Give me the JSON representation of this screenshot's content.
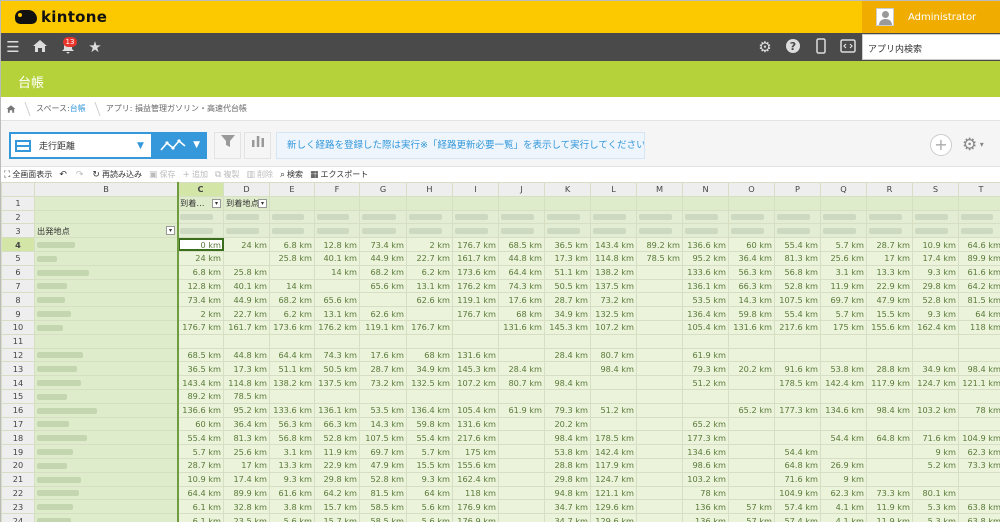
{
  "app": {
    "brand": "kintone",
    "user": "Administrator",
    "notification_count": "13",
    "app_search_label": "アプリ内検索",
    "title": "台帳"
  },
  "breadcrumb": {
    "space_prefix": "スペース:",
    "space_name": "台帳",
    "app_label": "アプリ: 損益管理ガソリン・高速代台帳"
  },
  "toolbar": {
    "view_name": "走行距離",
    "notice": "新しく経路を登録した際は実行※「経路更新必要一覧」を表示して実行してください"
  },
  "sheet_tools": [
    {
      "label": "全画面表示",
      "icon": "⛶",
      "enabled": true
    },
    {
      "label": "",
      "icon": "↶",
      "enabled": true
    },
    {
      "label": "",
      "icon": "↷",
      "enabled": false
    },
    {
      "label": "再読み込み",
      "icon": "↻",
      "enabled": true
    },
    {
      "label": "保存",
      "icon": "▣",
      "enabled": false
    },
    {
      "label": "追加",
      "icon": "+",
      "enabled": false
    },
    {
      "label": "複製",
      "icon": "⧉",
      "enabled": false
    },
    {
      "label": "削除",
      "icon": "▥",
      "enabled": false
    },
    {
      "label": "検索",
      "icon": "⌕",
      "enabled": true
    },
    {
      "label": "エクスポート",
      "icon": "▦",
      "enabled": true
    }
  ],
  "sheet": {
    "columns": [
      "B",
      "C",
      "D",
      "E",
      "F",
      "G",
      "H",
      "I",
      "J",
      "K",
      "L",
      "M",
      "N",
      "O",
      "P",
      "Q",
      "R",
      "S",
      "T"
    ],
    "selected_column": "C",
    "row1_labels": {
      "C": "到着…",
      "D": "到着地点"
    },
    "row3_label": "出発地点",
    "rows": [
      {
        "n": "4",
        "v": [
          "0 km",
          "24 km",
          "6.8 km",
          "12.8 km",
          "73.4 km",
          "2 km",
          "176.7 km",
          "68.5 km",
          "36.5 km",
          "143.4 km",
          "89.2 km",
          "136.6 km",
          "60 km",
          "55.4 km",
          "5.7 km",
          "28.7 km",
          "10.9 km",
          "64.6 km"
        ]
      },
      {
        "n": "5",
        "v": [
          "24 km",
          "",
          "25.8 km",
          "40.1 km",
          "44.9 km",
          "22.7 km",
          "161.7 km",
          "44.8 km",
          "17.3 km",
          "114.8 km",
          "78.5 km",
          "95.2 km",
          "36.4 km",
          "81.3 km",
          "25.6 km",
          "17 km",
          "17.4 km",
          "89.9 km"
        ]
      },
      {
        "n": "6",
        "v": [
          "6.8 km",
          "25.8 km",
          "",
          "14 km",
          "68.2 km",
          "6.2 km",
          "173.6 km",
          "64.4 km",
          "51.1 km",
          "138.2 km",
          "",
          "133.6 km",
          "56.3 km",
          "56.8 km",
          "3.1 km",
          "13.3 km",
          "9.3 km",
          "61.6 km"
        ]
      },
      {
        "n": "7",
        "v": [
          "12.8 km",
          "40.1 km",
          "14 km",
          "",
          "65.6 km",
          "13.1 km",
          "176.2 km",
          "74.3 km",
          "50.5 km",
          "137.5 km",
          "",
          "136.1 km",
          "66.3 km",
          "52.8 km",
          "11.9 km",
          "22.9 km",
          "29.8 km",
          "64.2 km"
        ]
      },
      {
        "n": "8",
        "v": [
          "73.4 km",
          "44.9 km",
          "68.2 km",
          "65.6 km",
          "",
          "62.6 km",
          "119.1 km",
          "17.6 km",
          "28.7 km",
          "73.2 km",
          "",
          "53.5 km",
          "14.3 km",
          "107.5 km",
          "69.7 km",
          "47.9 km",
          "52.8 km",
          "81.5 km"
        ]
      },
      {
        "n": "9",
        "v": [
          "2 km",
          "22.7 km",
          "6.2 km",
          "13.1 km",
          "62.6 km",
          "",
          "176.7 km",
          "68 km",
          "34.9 km",
          "132.5 km",
          "",
          "136.4 km",
          "59.8 km",
          "55.4 km",
          "5.7 km",
          "15.5 km",
          "9.3 km",
          "64 km"
        ]
      },
      {
        "n": "10",
        "v": [
          "176.7 km",
          "161.7 km",
          "173.6 km",
          "176.2 km",
          "119.1 km",
          "176.7 km",
          "",
          "131.6 km",
          "145.3 km",
          "107.2 km",
          "",
          "105.4 km",
          "131.6 km",
          "217.6 km",
          "175 km",
          "155.6 km",
          "162.4 km",
          "118 km"
        ]
      },
      {
        "n": "11",
        "v": [
          "",
          "",
          "",
          "",
          "",
          "",
          "",
          "",
          "",
          "",
          "",
          "",
          "",
          "",
          "",
          "",
          "",
          ""
        ]
      },
      {
        "n": "12",
        "v": [
          "68.5 km",
          "44.8 km",
          "64.4 km",
          "74.3 km",
          "17.6 km",
          "68 km",
          "131.6 km",
          "",
          "28.4 km",
          "80.7 km",
          "",
          "61.9 km",
          "",
          "",
          "",
          "",
          "",
          ""
        ]
      },
      {
        "n": "13",
        "v": [
          "36.5 km",
          "17.3 km",
          "51.1 km",
          "50.5 km",
          "28.7 km",
          "34.9 km",
          "145.3 km",
          "28.4 km",
          "",
          "98.4 km",
          "",
          "79.3 km",
          "20.2 km",
          "91.6 km",
          "53.8 km",
          "28.8 km",
          "34.9 km",
          "98.4 km"
        ]
      },
      {
        "n": "14",
        "v": [
          "143.4 km",
          "114.8 km",
          "138.2 km",
          "137.5 km",
          "73.2 km",
          "132.5 km",
          "107.2 km",
          "80.7 km",
          "98.4 km",
          "",
          "",
          "51.2 km",
          "",
          "178.5 km",
          "142.4 km",
          "117.9 km",
          "124.7 km",
          "121.1 km"
        ]
      },
      {
        "n": "15",
        "v": [
          "89.2 km",
          "78.5 km",
          "",
          "",
          "",
          "",
          "",
          "",
          "",
          "",
          "",
          "",
          "",
          "",
          "",
          "",
          "",
          ""
        ]
      },
      {
        "n": "16",
        "v": [
          "136.6 km",
          "95.2 km",
          "133.6 km",
          "136.1 km",
          "53.5 km",
          "136.4 km",
          "105.4 km",
          "61.9 km",
          "79.3 km",
          "51.2 km",
          "",
          "",
          "65.2 km",
          "177.3 km",
          "134.6 km",
          "98.4 km",
          "103.2 km",
          "78 km"
        ]
      },
      {
        "n": "17",
        "v": [
          "60 km",
          "36.4 km",
          "56.3 km",
          "66.3 km",
          "14.3 km",
          "59.8 km",
          "131.6 km",
          "",
          "20.2 km",
          "",
          "",
          "65.2 km",
          "",
          "",
          "",
          "",
          "",
          ""
        ]
      },
      {
        "n": "18",
        "v": [
          "55.4 km",
          "81.3 km",
          "56.8 km",
          "52.8 km",
          "107.5 km",
          "55.4 km",
          "217.6 km",
          "",
          "98.4 km",
          "178.5 km",
          "",
          "177.3 km",
          "",
          "",
          "54.4 km",
          "64.8 km",
          "71.6 km",
          "104.9 km"
        ]
      },
      {
        "n": "19",
        "v": [
          "5.7 km",
          "25.6 km",
          "3.1 km",
          "11.9 km",
          "69.7 km",
          "5.7 km",
          "175 km",
          "",
          "53.8 km",
          "142.4 km",
          "",
          "134.6 km",
          "",
          "54.4 km",
          "",
          "",
          "9 km",
          "62.3 km"
        ]
      },
      {
        "n": "20",
        "v": [
          "28.7 km",
          "17 km",
          "13.3 km",
          "22.9 km",
          "47.9 km",
          "15.5 km",
          "155.6 km",
          "",
          "28.8 km",
          "117.9 km",
          "",
          "98.6 km",
          "",
          "64.8 km",
          "26.9 km",
          "",
          "5.2 km",
          "73.3 km"
        ]
      },
      {
        "n": "21",
        "v": [
          "10.9 km",
          "17.4 km",
          "9.3 km",
          "29.8 km",
          "52.8 km",
          "9.3 km",
          "162.4 km",
          "",
          "29.8 km",
          "124.7 km",
          "",
          "103.2 km",
          "",
          "71.6 km",
          "9 km",
          "",
          "",
          ""
        ]
      },
      {
        "n": "22",
        "v": [
          "64.4 km",
          "89.9 km",
          "61.6 km",
          "64.2 km",
          "81.5 km",
          "64 km",
          "118 km",
          "",
          "94.8 km",
          "121.1 km",
          "",
          "78 km",
          "",
          "104.9 km",
          "62.3 km",
          "73.3 km",
          "80.1 km",
          ""
        ]
      },
      {
        "n": "23",
        "v": [
          "6.1 km",
          "32.8 km",
          "3.8 km",
          "15.7 km",
          "58.5 km",
          "5.6 km",
          "176.9 km",
          "",
          "34.7 km",
          "129.6 km",
          "",
          "136 km",
          "57 km",
          "57.4 km",
          "4.1 km",
          "11.9 km",
          "5.3 km",
          "63.8 km"
        ]
      },
      {
        "n": "24",
        "v": [
          "6.1 km",
          "23.5 km",
          "5.6 km",
          "15.7 km",
          "58.5 km",
          "5.6 km",
          "176.9 km",
          "",
          "34.7 km",
          "129.6 km",
          "",
          "136 km",
          "57 km",
          "57.4 km",
          "4.1 km",
          "11.9 km",
          "5.3 km",
          "63.8 km"
        ]
      }
    ]
  }
}
